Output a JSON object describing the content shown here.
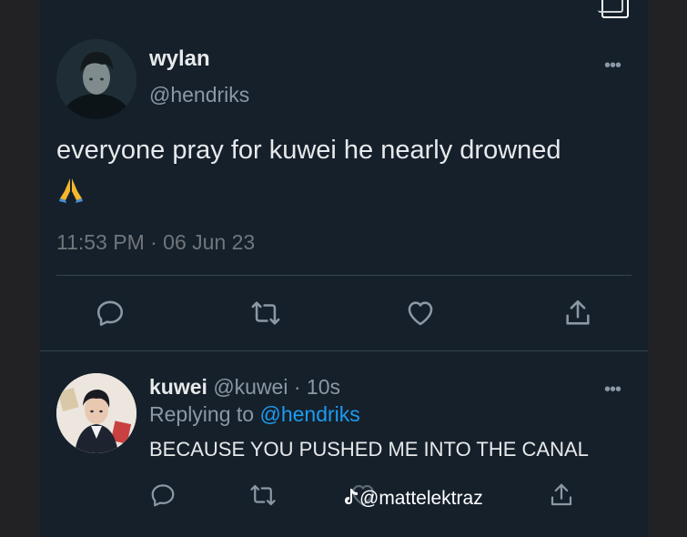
{
  "tweet": {
    "display_name": "wylan",
    "handle": "@hendriks",
    "text": "everyone pray for kuwei he nearly drowned",
    "emoji": "pray-emoji",
    "timestamp": "11:53 PM · 06 Jun 23",
    "more": "•••",
    "actions": [
      "reply-icon",
      "retweet-icon",
      "like-icon",
      "share-icon"
    ]
  },
  "reply": {
    "display_name": "kuwei",
    "handle_time": "@kuwei · 10s",
    "replying_prefix": "Replying to",
    "replying_to": "@hendriks",
    "text": "BECAUSE YOU PUSHED ME INTO THE CANAL",
    "more": "•••"
  },
  "watermark": {
    "text": "@mattelektraz",
    "icon": "tiktok-icon"
  },
  "colors": {
    "background": "#15202b",
    "text": "#e7e9ea",
    "muted": "#8b98a5",
    "link": "#1d9bf0",
    "divider": "#38444d"
  }
}
